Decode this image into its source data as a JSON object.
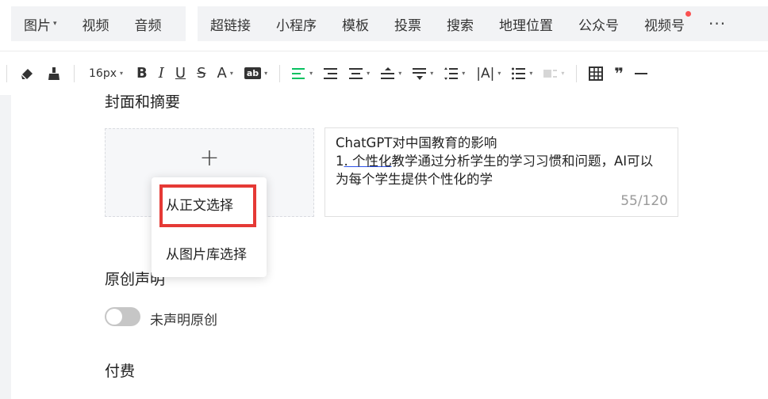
{
  "insert_toolbar": {
    "group1": [
      {
        "label": "图片",
        "has_caret": true
      },
      {
        "label": "视频"
      },
      {
        "label": "音频"
      }
    ],
    "group2": [
      {
        "label": "超链接"
      },
      {
        "label": "小程序"
      },
      {
        "label": "模板"
      },
      {
        "label": "投票"
      },
      {
        "label": "搜索"
      },
      {
        "label": "地理位置"
      },
      {
        "label": "公众号"
      },
      {
        "label": "视频号",
        "notification_dot": true
      }
    ],
    "more_label": "···"
  },
  "format_toolbar": {
    "font_size": "16px",
    "bold": "B",
    "italic": "I",
    "underline": "U",
    "strikethrough": "S",
    "font_color": "A",
    "bg_color": "ab",
    "quote": "❞",
    "accent_color": "#07c160"
  },
  "cover_section": {
    "title": "封面和摘要",
    "add_symbol": "+"
  },
  "abstract": {
    "line1": "ChatGPT对中国教育的影响",
    "line2_prefix": "1",
    "line2_underlined": ". 个性化",
    "line2_rest": "教学通过分析学生的学习习惯和问题，AI可以",
    "line3": "为每个学生提供个性化的学",
    "counter": "55/120"
  },
  "cover_popup": {
    "options": [
      "从正文选择",
      "从图片库选择"
    ],
    "highlight_color": "#e53935"
  },
  "original_section": {
    "title": "原创声明",
    "toggle_label": "未声明原创",
    "toggle_on": false
  },
  "pay_section": {
    "title": "付费"
  }
}
